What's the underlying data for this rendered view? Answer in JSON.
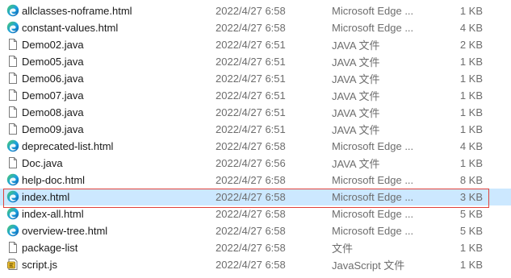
{
  "files": [
    {
      "name": "allclasses-noframe.html",
      "date": "2022/4/27 6:58",
      "type": "Microsoft Edge ...",
      "size": "1 KB",
      "icon": "edge-icon",
      "selected": false
    },
    {
      "name": "constant-values.html",
      "date": "2022/4/27 6:58",
      "type": "Microsoft Edge ...",
      "size": "4 KB",
      "icon": "edge-icon",
      "selected": false
    },
    {
      "name": "Demo02.java",
      "date": "2022/4/27 6:51",
      "type": "JAVA 文件",
      "size": "2 KB",
      "icon": "file-icon",
      "selected": false
    },
    {
      "name": "Demo05.java",
      "date": "2022/4/27 6:51",
      "type": "JAVA 文件",
      "size": "1 KB",
      "icon": "file-icon",
      "selected": false
    },
    {
      "name": "Demo06.java",
      "date": "2022/4/27 6:51",
      "type": "JAVA 文件",
      "size": "1 KB",
      "icon": "file-icon",
      "selected": false
    },
    {
      "name": "Demo07.java",
      "date": "2022/4/27 6:51",
      "type": "JAVA 文件",
      "size": "1 KB",
      "icon": "file-icon",
      "selected": false
    },
    {
      "name": "Demo08.java",
      "date": "2022/4/27 6:51",
      "type": "JAVA 文件",
      "size": "1 KB",
      "icon": "file-icon",
      "selected": false
    },
    {
      "name": "Demo09.java",
      "date": "2022/4/27 6:51",
      "type": "JAVA 文件",
      "size": "1 KB",
      "icon": "file-icon",
      "selected": false
    },
    {
      "name": "deprecated-list.html",
      "date": "2022/4/27 6:58",
      "type": "Microsoft Edge ...",
      "size": "4 KB",
      "icon": "edge-icon",
      "selected": false
    },
    {
      "name": "Doc.java",
      "date": "2022/4/27 6:56",
      "type": "JAVA 文件",
      "size": "1 KB",
      "icon": "file-icon",
      "selected": false
    },
    {
      "name": "help-doc.html",
      "date": "2022/4/27 6:58",
      "type": "Microsoft Edge ...",
      "size": "8 KB",
      "icon": "edge-icon",
      "selected": false
    },
    {
      "name": "index.html",
      "date": "2022/4/27 6:58",
      "type": "Microsoft Edge ...",
      "size": "3 KB",
      "icon": "edge-icon",
      "selected": true
    },
    {
      "name": "index-all.html",
      "date": "2022/4/27 6:58",
      "type": "Microsoft Edge ...",
      "size": "5 KB",
      "icon": "edge-icon",
      "selected": false
    },
    {
      "name": "overview-tree.html",
      "date": "2022/4/27 6:58",
      "type": "Microsoft Edge ...",
      "size": "5 KB",
      "icon": "edge-icon",
      "selected": false
    },
    {
      "name": "package-list",
      "date": "2022/4/27 6:58",
      "type": "文件",
      "size": "1 KB",
      "icon": "file-icon",
      "selected": false
    },
    {
      "name": "script.js",
      "date": "2022/4/27 6:58",
      "type": "JavaScript 文件",
      "size": "1 KB",
      "icon": "script-icon",
      "selected": false
    }
  ],
  "colors": {
    "selection": "#cce8ff",
    "highlight_border": "#e0413a",
    "edge_blue": "#0c59a4",
    "edge_green": "#4fcc6b"
  }
}
